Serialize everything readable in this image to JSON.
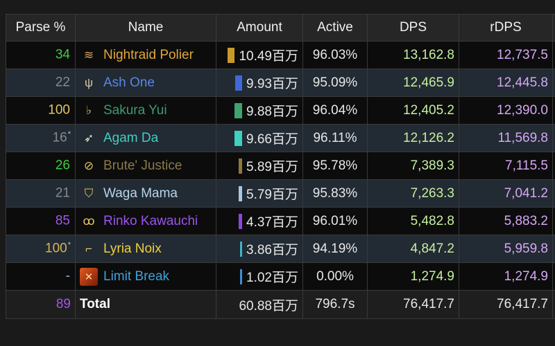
{
  "headers": {
    "parse": "Parse %",
    "name": "Name",
    "amount": "Amount",
    "active": "Active",
    "dps": "DPS",
    "rdps": "rDPS"
  },
  "rows": [
    {
      "parse": "34",
      "parse_mark": "",
      "parse_color": "#3ccf3c",
      "name": "Nightraid Polier",
      "name_color": "#e3a83a",
      "job_icon": "ninja-icon",
      "job_glyph": "≋",
      "job_color": "#d6a657",
      "amount": "10.49百万",
      "bar_color": "#c99a2a",
      "active": "96.03%",
      "dps": "13,162.8",
      "rdps": "12,737.5"
    },
    {
      "parse": "22",
      "parse_mark": "",
      "parse_color": "#8a8a8a",
      "name": "Ash One",
      "name_color": "#5a86e8",
      "job_icon": "summoner-icon",
      "job_glyph": "ψ",
      "job_color": "#d9c8a0",
      "amount": "9.93百万",
      "bar_color": "#3f69d8",
      "active": "95.09%",
      "dps": "12,465.9",
      "rdps": "12,445.8"
    },
    {
      "parse": "100",
      "parse_mark": "",
      "parse_color": "#e2c66a",
      "name": "Sakura Yui",
      "name_color": "#3f9a6f",
      "job_icon": "bard-icon",
      "job_glyph": "♭",
      "job_color": "#e2c06a",
      "amount": "9.88百万",
      "bar_color": "#3fa36f",
      "active": "96.04%",
      "dps": "12,405.2",
      "rdps": "12,390.0"
    },
    {
      "parse": "16",
      "parse_mark": "*",
      "parse_color": "#8a8a8a",
      "name": "Agam Da",
      "name_color": "#3fd0c2",
      "job_icon": "dancer-icon",
      "job_glyph": "➶",
      "job_color": "#e6e0d0",
      "amount": "9.66百万",
      "bar_color": "#3fd0c2",
      "active": "96.11%",
      "dps": "12,126.2",
      "rdps": "11,569.8"
    },
    {
      "parse": "26",
      "parse_mark": "",
      "parse_color": "#3ccf3c",
      "name": "Brute' Justice",
      "name_color": "#8a7a4a",
      "job_icon": "gunbreaker-icon",
      "job_glyph": "⊘",
      "job_color": "#e2c06a",
      "amount": "5.89百万",
      "bar_color": "#8e7a3e",
      "active": "95.78%",
      "dps": "7,389.3",
      "rdps": "7,115.5"
    },
    {
      "parse": "21",
      "parse_mark": "",
      "parse_color": "#8a8a8a",
      "name": "Waga Mama",
      "name_color": "#b7d4ea",
      "job_icon": "paladin-icon",
      "job_glyph": "⛉",
      "job_color": "#e2c06a",
      "amount": "5.79百万",
      "bar_color": "#a6c8e2",
      "active": "95.83%",
      "dps": "7,263.3",
      "rdps": "7,041.2"
    },
    {
      "parse": "85",
      "parse_mark": "",
      "parse_color": "#a455ea",
      "name": "Rinko Kawauchi",
      "name_color": "#9a55ea",
      "job_icon": "sage-icon",
      "job_glyph": "ꝏ",
      "job_color": "#e2c06a",
      "amount": "4.37百万",
      "bar_color": "#8d45e0",
      "active": "96.01%",
      "dps": "5,482.8",
      "rdps": "5,883.2"
    },
    {
      "parse": "100",
      "parse_mark": "*",
      "parse_color": "#d8b657",
      "name": "Lyria Noix",
      "name_color": "#f0d040",
      "job_icon": "machinist-icon",
      "job_glyph": "⌐",
      "job_color": "#e2c06a",
      "amount": "3.86百万",
      "bar_color": "#3fb5c8",
      "active": "94.19%",
      "dps": "4,847.2",
      "rdps": "5,959.8"
    },
    {
      "parse": "-",
      "parse_mark": "",
      "parse_color": "#8ab8e8",
      "name": "Limit Break",
      "name_color": "#3fa3d8",
      "job_icon": "limit-break-icon",
      "job_glyph": "✕",
      "job_color": "#ffd4a0",
      "amount": "1.02百万",
      "bar_color": "#3f8ed8",
      "active": "0.00%",
      "dps": "1,274.9",
      "rdps": "1,274.9"
    }
  ],
  "total": {
    "parse": "89",
    "parse_color": "#a455ea",
    "name": "Total",
    "amount": "60.88百万",
    "active": "796.7s",
    "dps": "76,417.7",
    "rdps": "76,417.7"
  }
}
